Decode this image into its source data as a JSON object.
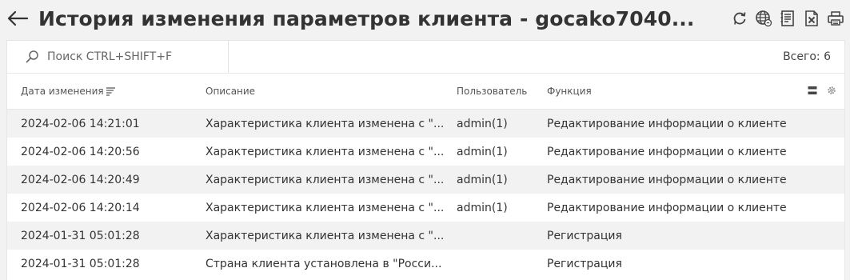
{
  "header": {
    "title": "История изменения параметров клиента - gocako7040...",
    "actions": [
      {
        "name": "refresh-icon"
      },
      {
        "name": "globe-icon"
      },
      {
        "name": "document-list-icon"
      },
      {
        "name": "excel-export-icon"
      },
      {
        "name": "print-icon"
      }
    ]
  },
  "toolbar": {
    "search_placeholder": "Поиск CTRL+SHIFT+F",
    "total": "Всего: 6"
  },
  "table": {
    "columns": [
      "Дата изменения",
      "Описание",
      "Пользователь",
      "Функция"
    ],
    "rows": [
      {
        "date": "2024-02-06 14:21:01",
        "description": "Характеристика клиента изменена с \"...",
        "user": "admin(1)",
        "function": "Редактирование информации о клиенте"
      },
      {
        "date": "2024-02-06 14:20:56",
        "description": "Характеристика клиента изменена с \"...",
        "user": "admin(1)",
        "function": "Редактирование информации о клиенте"
      },
      {
        "date": "2024-02-06 14:20:49",
        "description": "Характеристика клиента изменена с \"...",
        "user": "admin(1)",
        "function": "Редактирование информации о клиенте"
      },
      {
        "date": "2024-02-06 14:20:14",
        "description": "Характеристика клиента изменена с \"...",
        "user": "admin(1)",
        "function": "Редактирование информации о клиенте"
      },
      {
        "date": "2024-01-31 05:01:28",
        "description": "Характеристика клиента изменена с \"...",
        "user": "",
        "function": "Регистрация"
      },
      {
        "date": "2024-01-31 05:01:28",
        "description": "Страна клиента установлена в \"Росси...",
        "user": "",
        "function": "Регистрация"
      }
    ]
  },
  "colors": {
    "row_stripe": "#f2f2f2",
    "background": "#ffffff",
    "text": "#333333"
  }
}
